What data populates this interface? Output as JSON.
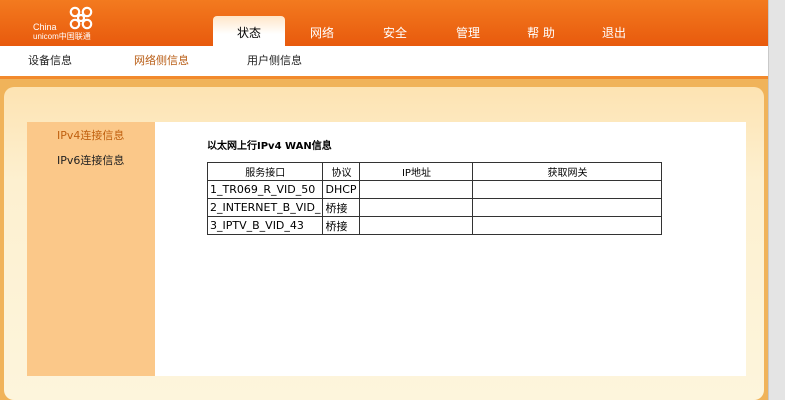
{
  "brand": {
    "line1": "China",
    "line2": "unicom中国联通"
  },
  "top_tabs": [
    {
      "label": "状态",
      "active": true
    },
    {
      "label": "网络",
      "active": false
    },
    {
      "label": "安全",
      "active": false
    },
    {
      "label": "管理",
      "active": false
    },
    {
      "label": "帮 助",
      "active": false
    },
    {
      "label": "退出",
      "active": false
    }
  ],
  "sub_nav": [
    {
      "label": "设备信息",
      "active": false
    },
    {
      "label": "网络侧信息",
      "active": true
    },
    {
      "label": "用户侧信息",
      "active": false
    }
  ],
  "sidebar": [
    {
      "label": "IPv4连接信息",
      "active": true
    },
    {
      "label": "IPv6连接信息",
      "active": false
    }
  ],
  "content": {
    "title": "以太网上行IPv4 WAN信息",
    "table": {
      "headers": [
        "服务接口",
        "协议",
        "IP地址",
        "获取网关"
      ],
      "rows": [
        [
          "1_TR069_R_VID_50",
          "DHCP",
          "",
          ""
        ],
        [
          "2_INTERNET_B_VID_",
          "桥接",
          "",
          ""
        ],
        [
          "3_IPTV_B_VID_43",
          "桥接",
          "",
          ""
        ]
      ]
    }
  },
  "colors": {
    "header": "#e85a0d",
    "sidebar": "#fbc889",
    "frame": "#f0b35a"
  }
}
